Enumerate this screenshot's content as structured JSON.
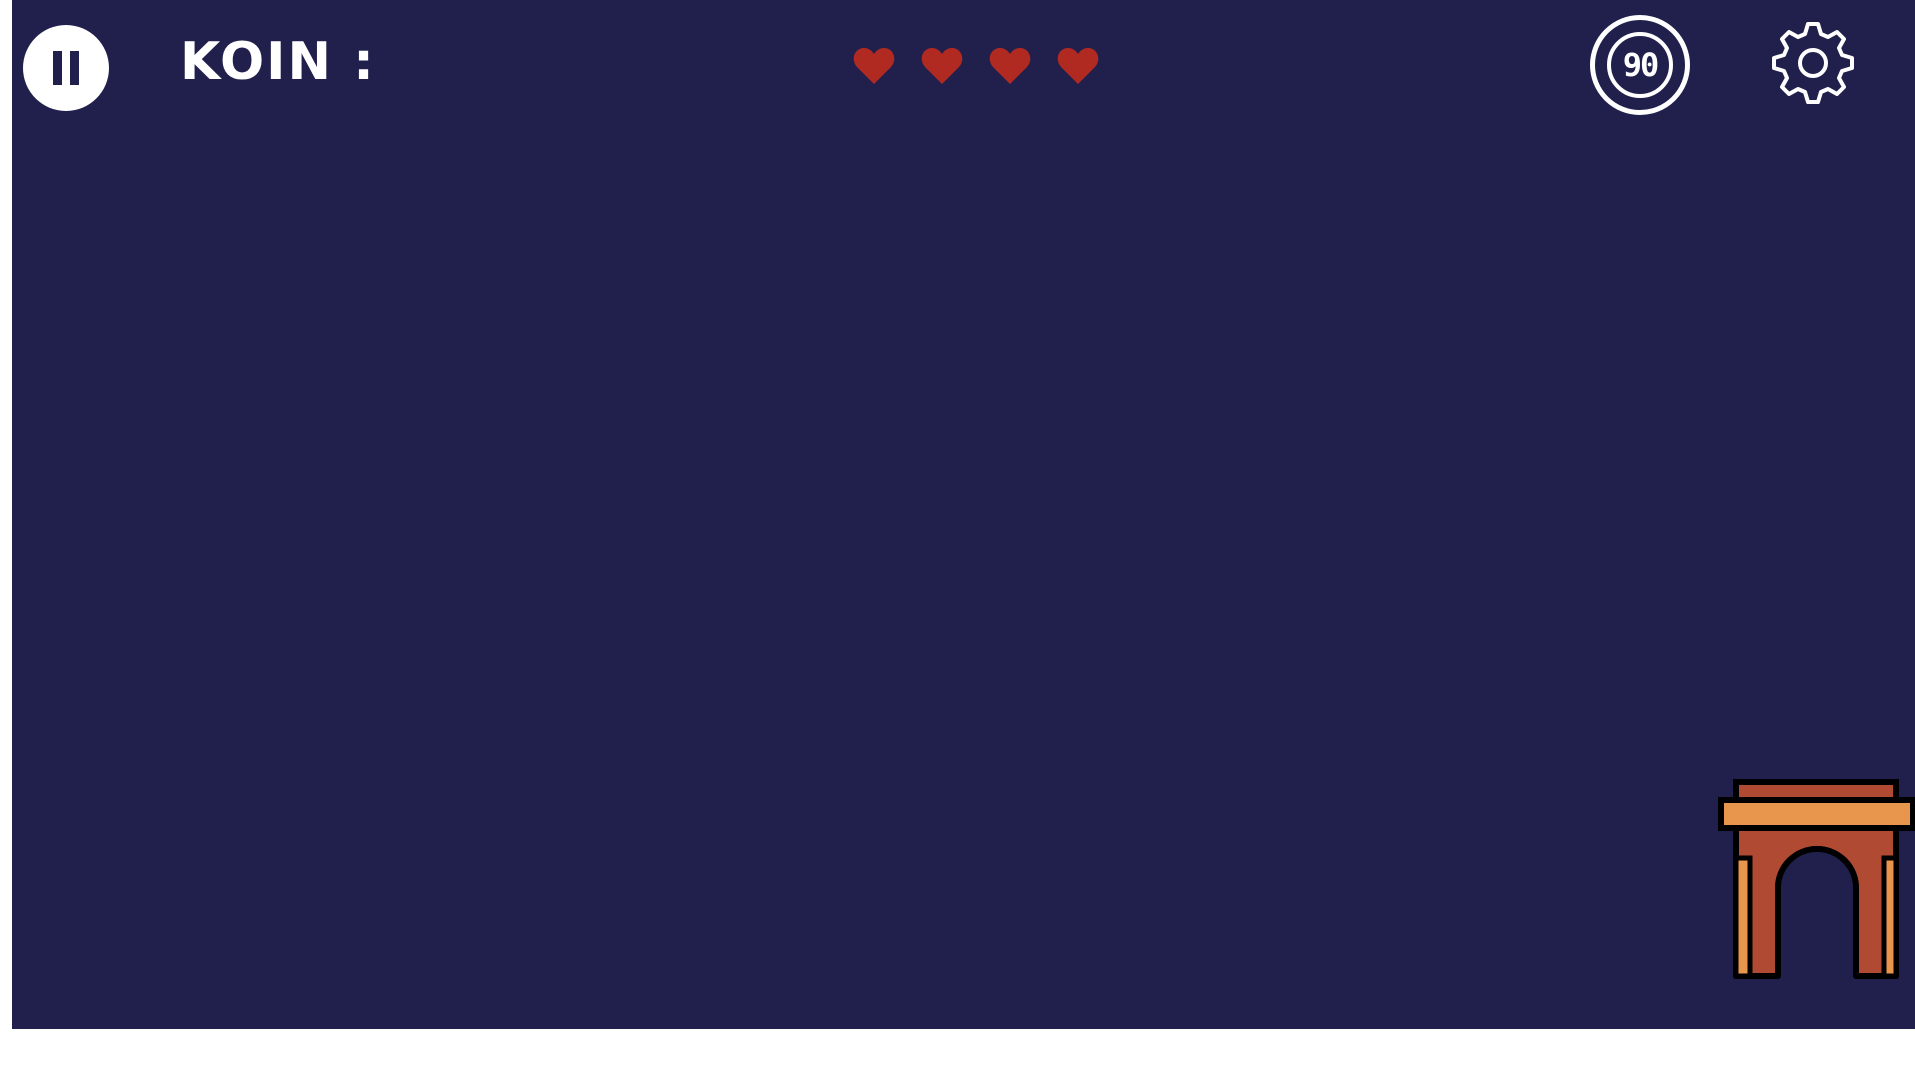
{
  "hud": {
    "koin_label": "KOIN :",
    "koin_value": "",
    "lives": 4,
    "timer_value": "90"
  },
  "icons": {
    "pause": "pause-icon",
    "heart": "heart-icon",
    "timer": "timer-badge",
    "settings": "gear-icon",
    "landmark": "arch-gate-icon"
  },
  "colors": {
    "background": "#21204c",
    "heart": "#b02a22",
    "hud_text": "#ffffff",
    "arch_dark": "#b04a33",
    "arch_light": "#e8954d"
  }
}
